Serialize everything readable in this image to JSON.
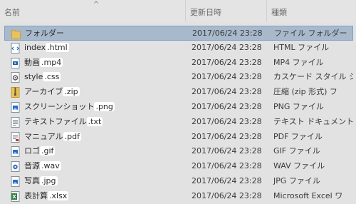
{
  "header": {
    "name_label": "名前",
    "date_label": "更新日時",
    "type_label": "種類",
    "sort_arrow": "^"
  },
  "files": [
    {
      "base": "フォルダー",
      "ext": "",
      "date": "2017/06/24 23:28",
      "type": "ファイル フォルダー",
      "icon": "folder-icon",
      "selected": true
    },
    {
      "base": "index",
      "ext": ".html",
      "date": "2017/06/24 23:28",
      "type": "HTML ファイル",
      "icon": "html-file-icon"
    },
    {
      "base": "動画",
      "ext": ".mp4",
      "date": "2017/06/24 23:28",
      "type": "MP4 ファイル",
      "icon": "video-file-icon"
    },
    {
      "base": "style",
      "ext": ".css",
      "date": "2017/06/24 23:28",
      "type": "カスケード スタイル シ",
      "icon": "css-file-icon"
    },
    {
      "base": "アーカイブ",
      "ext": ".zip",
      "date": "2017/06/24 23:28",
      "type": "圧縮 (zip 形式) フ",
      "icon": "zip-file-icon"
    },
    {
      "base": "スクリーンショット",
      "ext": ".png",
      "date": "2017/06/24 23:28",
      "type": "PNG ファイル",
      "icon": "image-file-icon"
    },
    {
      "base": "テキストファイル",
      "ext": ".txt",
      "date": "2017/06/24 23:28",
      "type": "テキスト ドキュメント",
      "icon": "text-file-icon"
    },
    {
      "base": "マニュアル",
      "ext": ".pdf",
      "date": "2017/06/24 23:28",
      "type": "PDF ファイル",
      "icon": "pdf-file-icon"
    },
    {
      "base": "ロゴ",
      "ext": ".gif",
      "date": "2017/06/24 23:28",
      "type": "GIF ファイル",
      "icon": "image-file-icon"
    },
    {
      "base": "音源",
      "ext": ".wav",
      "date": "2017/06/24 23:28",
      "type": "WAV ファイル",
      "icon": "audio-file-icon"
    },
    {
      "base": "写真",
      "ext": ".jpg",
      "date": "2017/06/24 23:28",
      "type": "JPG ファイル",
      "icon": "image-file-icon"
    },
    {
      "base": "表計算",
      "ext": ".xlsx",
      "date": "2017/06/24 23:28",
      "type": "Microsoft Excel ワ",
      "icon": "excel-file-icon"
    }
  ],
  "colors": {
    "background": "#e2e2e2",
    "selected_row": "#a8b9cc",
    "folder": "#e8c25a",
    "excel": "#2f7d3c"
  }
}
